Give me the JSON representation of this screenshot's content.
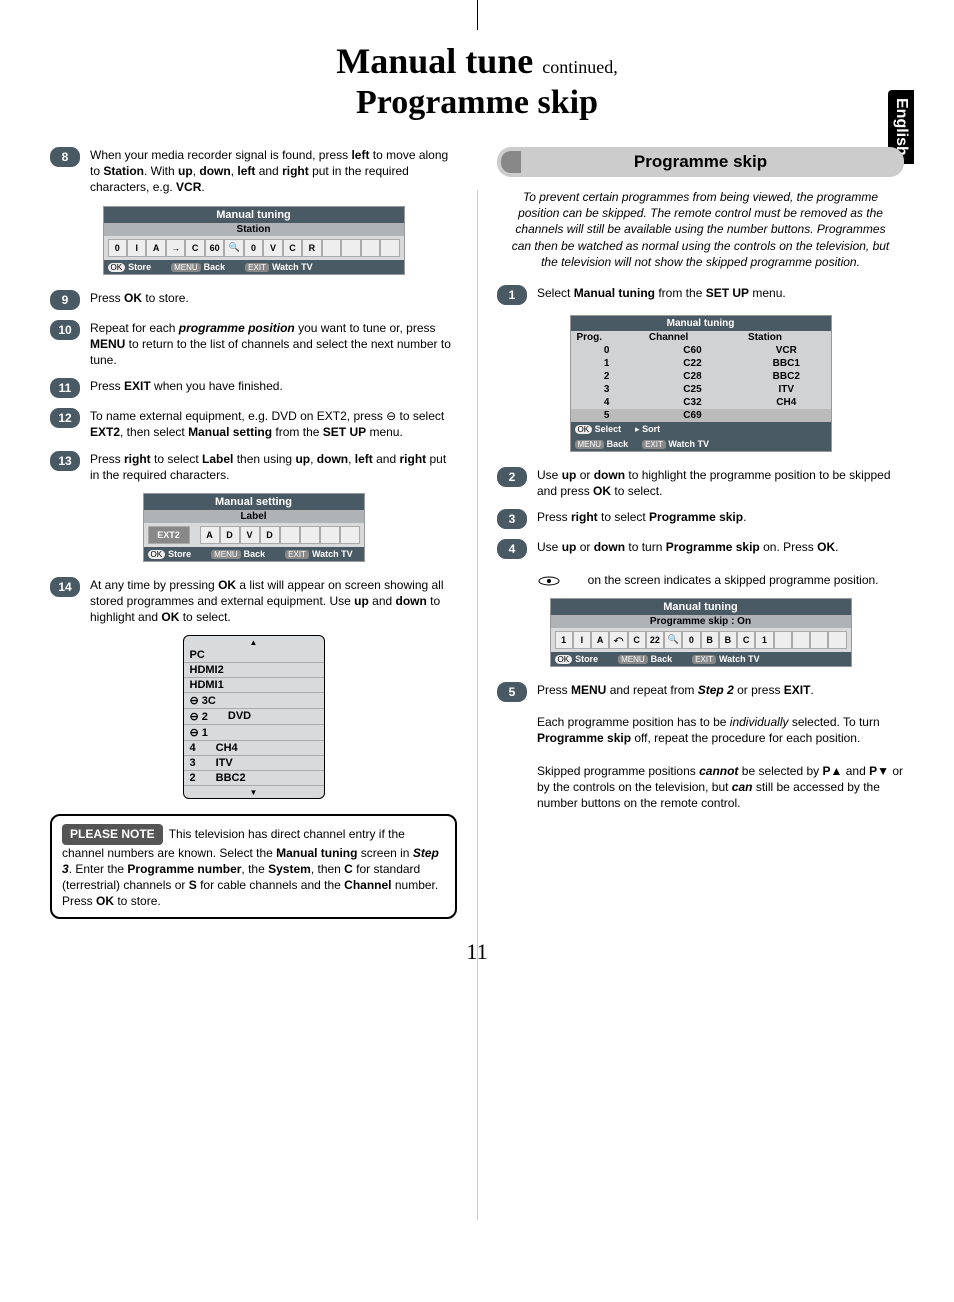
{
  "lang_tab": "English",
  "page_number": "11",
  "title": {
    "line1_a": "Manual tune",
    "line1_b": "continued,",
    "line2": "Programme skip"
  },
  "left": {
    "s8": "When your media recorder signal is found, press <b>left</b> to move along to <b>Station</b>. With <b>up</b>, <b>down</b>, <b>left</b> and <b>right</b> put in the required characters, e.g. <b>VCR</b>.",
    "s9": "Press <b>OK</b> to store.",
    "s10": "Repeat for each <b><i>programme position</i></b> you want to tune or, press <b>MENU</b> to return to the list of channels and select the next number to tune.",
    "s11": "Press <b>EXIT</b> when you have finished.",
    "s12": "To name external equipment, e.g. DVD on EXT2, press ⊖ to select <b>EXT2</b>, then select <b>Manual setting</b> from the <b>SET UP</b> menu.",
    "s13": "Press <b>right</b> to select <b>Label</b> then using <b>up</b>, <b>down</b>, <b>left</b> and <b>right</b> put in the required characters.",
    "s14": "At any time by pressing <b>OK</b> a list will appear on screen showing all stored programmes and external equipment. Use <b>up</b> and <b>down</b> to highlight and <b>OK</b> to select."
  },
  "osd_station": {
    "title": "Manual tuning",
    "sub": "Station",
    "cells": [
      "0",
      "I",
      "A",
      "→",
      "C",
      "60",
      "🔍",
      "0",
      "V",
      "C",
      "R",
      "",
      "",
      "",
      ""
    ],
    "footer_ok": "OK",
    "footer_store": "Store",
    "footer_menu": "MENU",
    "footer_back": "Back",
    "footer_exit": "EXIT",
    "footer_watch": "Watch TV"
  },
  "osd_label": {
    "title": "Manual setting",
    "sub": "Label",
    "ext": "EXT2",
    "cells": [
      "A",
      "D",
      "V",
      "D",
      "",
      "",
      "",
      ""
    ],
    "footer_ok": "OK",
    "footer_store": "Store",
    "footer_menu": "MENU",
    "footer_back": "Back",
    "footer_exit": "EXIT",
    "footer_watch": "Watch TV"
  },
  "list_box": [
    [
      "PC",
      ""
    ],
    [
      "HDMI2",
      ""
    ],
    [
      "HDMI1",
      ""
    ],
    [
      "⊖ 3C",
      ""
    ],
    [
      "⊖ 2",
      "DVD"
    ],
    [
      "⊖ 1",
      ""
    ],
    [
      "4",
      "CH4"
    ],
    [
      "3",
      "ITV"
    ],
    [
      "2",
      "BBC2"
    ]
  ],
  "note": {
    "badge": "PLEASE NOTE",
    "text": "This television has direct channel entry if the channel numbers are known. Select the <b>Manual tuning</b> screen in <b><i>Step 3</i></b>. Enter the <b>Programme number</b>, the <b>System</b>, then <b>C</b> for standard (terrestrial) channels or <b>S</b> for cable channels and the <b>Channel</b> number. Press <b>OK</b> to store."
  },
  "right": {
    "section": "Programme skip",
    "intro": "To prevent certain programmes from being viewed, the programme position can be skipped. The remote control must be removed as the channels will still be available using the number buttons. Programmes can then be watched as normal using the controls on the television, but the television will not show the skipped programme position.",
    "s1": "Select <b>Manual tuning</b> from the <b>SET UP</b> menu.",
    "s2": "Use <b>up</b> or <b>down</b> to highlight the programme position to be skipped and press <b>OK</b> to select.",
    "s3": "Press <b>right</b> to select <b>Programme skip</b>.",
    "s4": "Use <b>up</b> or <b>down</b> to turn <b>Programme skip</b> on. Press <b>OK</b>.",
    "s4b": "&nbsp;&nbsp;&nbsp;&nbsp;&nbsp;&nbsp;&nbsp; on the screen indicates a skipped programme position.",
    "s5": "Press <b>MENU</b> and repeat from <b><i>Step 2</i></b> or press <b>EXIT</b>.",
    "s5b": "Each programme position has to be <i>individually</i> selected. To turn <b>Programme skip</b> off, repeat the procedure for each position.",
    "s5c": "Skipped programme positions <b><i>cannot</i></b> be selected by <b>P▲</b> and <b>P▼</b> or by the controls on the television, but <b><i>can</i></b> still be accessed by the number buttons on the remote control."
  },
  "osd_prog_table": {
    "title": "Manual tuning",
    "head": [
      "Prog.",
      "Channel",
      "Station"
    ],
    "rows": [
      [
        "0",
        "C60",
        "VCR"
      ],
      [
        "1",
        "C22",
        "BBC1"
      ],
      [
        "2",
        "C28",
        "BBC2"
      ],
      [
        "3",
        "C25",
        "ITV"
      ],
      [
        "4",
        "C32",
        "CH4"
      ],
      [
        "5",
        "C69",
        ""
      ]
    ],
    "footer_ok": "OK",
    "footer_select": "Select",
    "footer_sort": "Sort",
    "footer_menu": "MENU",
    "footer_back": "Back",
    "footer_exit": "EXIT",
    "footer_watch": "Watch TV"
  },
  "osd_skip": {
    "title": "Manual tuning",
    "sub": "Programme skip : On",
    "cells": [
      "1",
      "I",
      "A",
      "⤺",
      "C",
      "22",
      "🔍",
      "0",
      "B",
      "B",
      "C",
      "1",
      "",
      "",
      "",
      ""
    ],
    "footer_ok": "OK",
    "footer_store": "Store",
    "footer_menu": "MENU",
    "footer_back": "Back",
    "footer_exit": "EXIT",
    "footer_watch": "Watch TV"
  }
}
